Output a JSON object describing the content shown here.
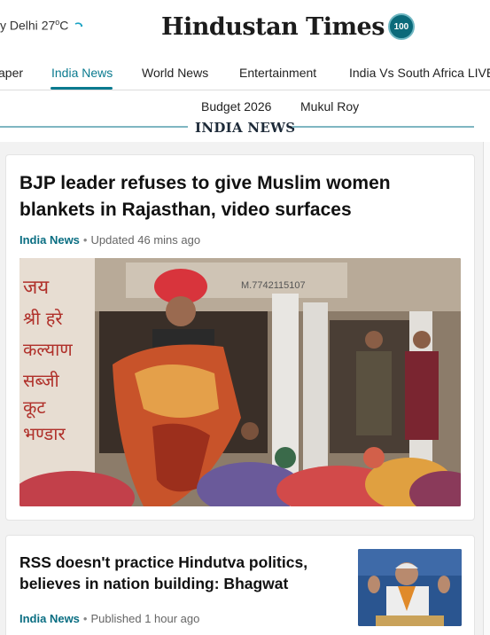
{
  "header": {
    "weather_city": "y Delhi",
    "weather_temp": "27",
    "weather_unit_sup": "o",
    "weather_unit": "C",
    "weather_icon": "cloud-icon",
    "logo_text": "Hindustan Times",
    "logo_badge": "100"
  },
  "nav": {
    "items": [
      {
        "label": "aper"
      },
      {
        "label": "India News"
      },
      {
        "label": "World News"
      },
      {
        "label": "Entertainment"
      },
      {
        "label": "India Vs South Africa LIVE"
      }
    ],
    "active_index": 1
  },
  "subnav": {
    "items": [
      {
        "label": "Budget 2026"
      },
      {
        "label": "Mukul Roy"
      }
    ]
  },
  "section": {
    "title": "INDIA NEWS"
  },
  "articles": [
    {
      "headline": "BJP leader refuses to give Muslim women blankets in Rajasthan, video surfaces",
      "category": "India News",
      "separator": "•",
      "time": "Updated 46 mins ago",
      "photo_wall_text": [
        "जय",
        "श्री हरे",
        "कल्याण",
        "सब्जी",
        "कूट",
        "भण्डार"
      ],
      "photo_sign_text": "M.7742115107"
    },
    {
      "headline": "RSS doesn't practice Hindutva politics, believes in nation building: Bhagwat",
      "category": "India News",
      "separator": "•",
      "time": "Published 1 hour ago"
    }
  ],
  "colors": {
    "accent": "#0a7a8f",
    "category": "#0a6e82",
    "feed_bg": "#f2f2f2"
  }
}
